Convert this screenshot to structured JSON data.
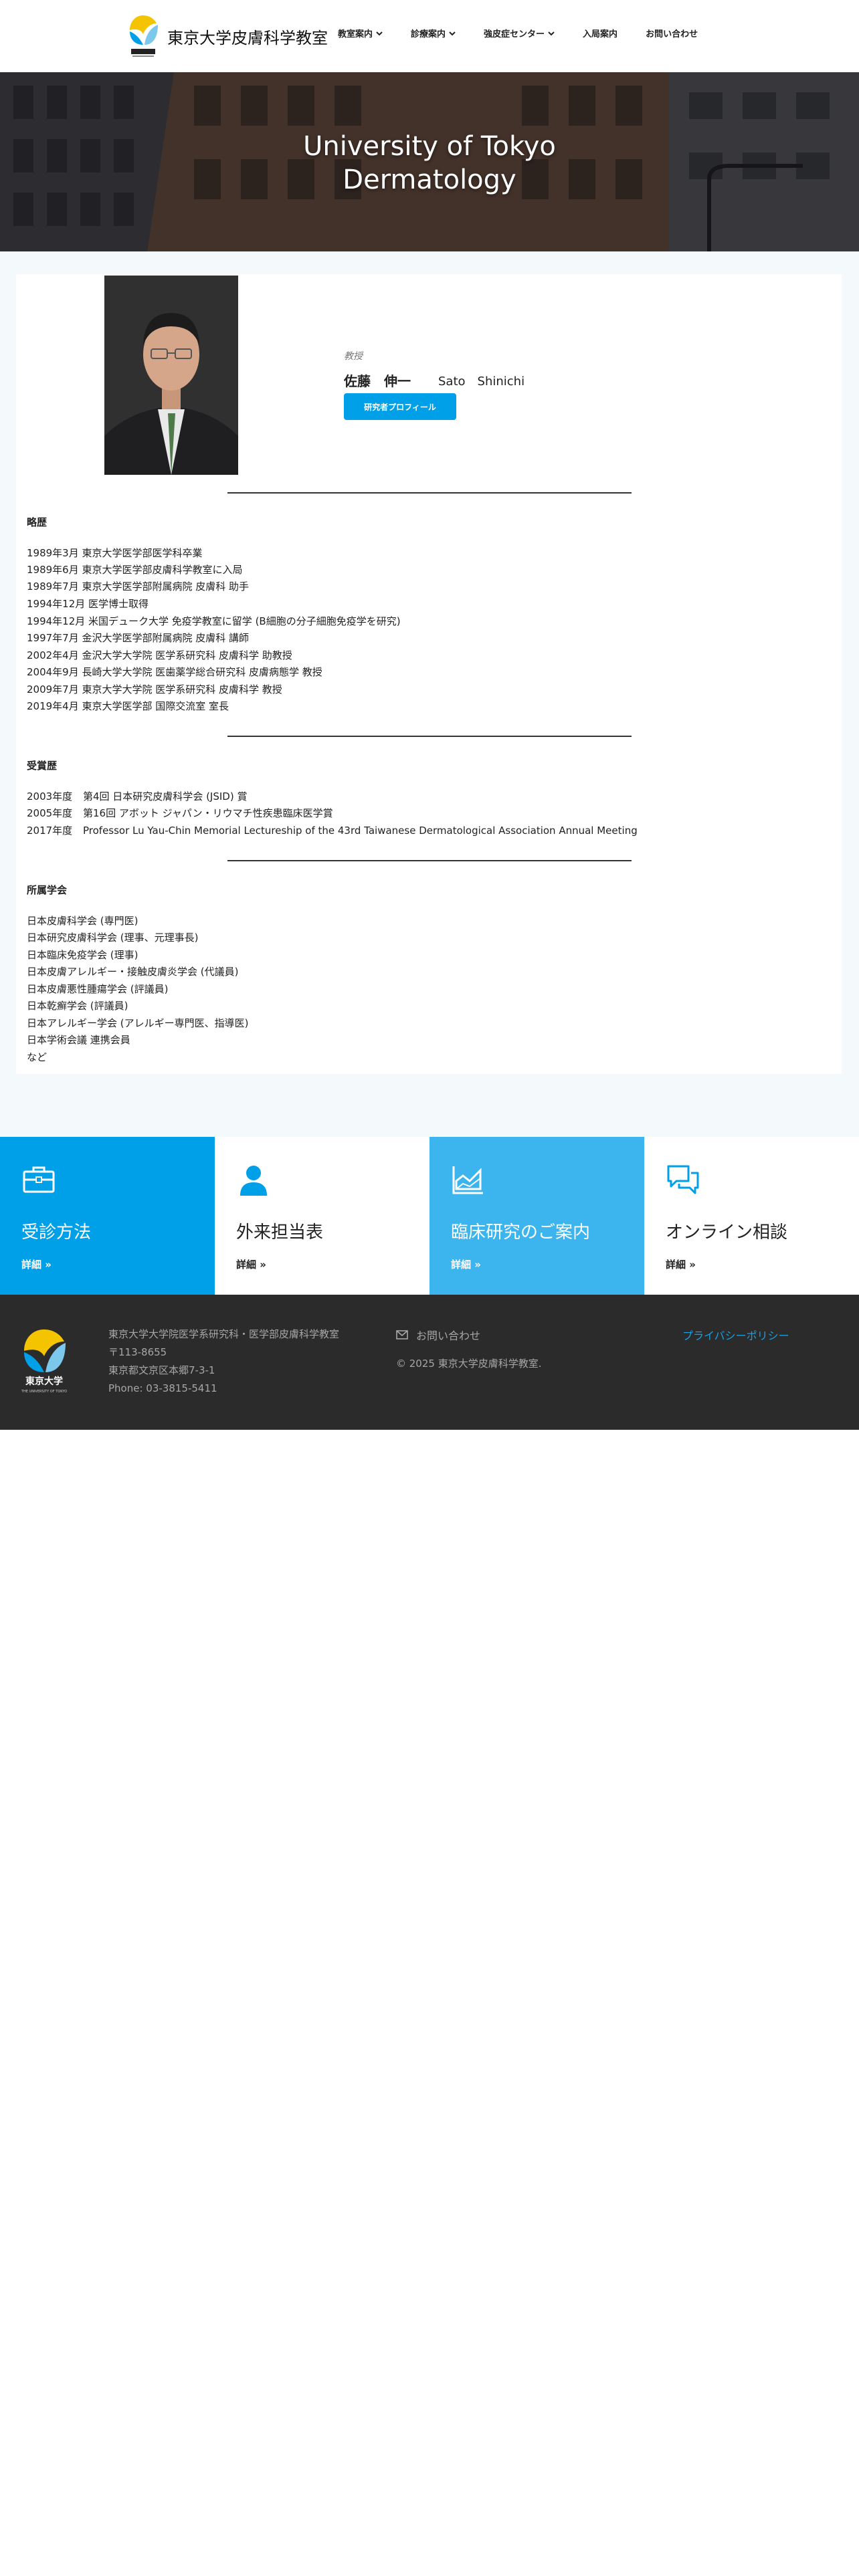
{
  "header": {
    "site_title": "東京大学皮膚科学教室",
    "logo_caption": "東京大学",
    "nav": [
      {
        "label": "教室案内",
        "dropdown": true
      },
      {
        "label": "診療案内",
        "dropdown": true
      },
      {
        "label": "強皮症センター",
        "dropdown": true
      },
      {
        "label": "入局案内",
        "dropdown": false
      },
      {
        "label": "お問い合わせ",
        "dropdown": false
      }
    ]
  },
  "hero": {
    "title_line1": "University of Tokyo",
    "title_line2": "Dermatology"
  },
  "profile": {
    "role": "教授",
    "name_ja": "佐藤　伸一",
    "name_en": "Sato　Shinichi",
    "button_label": "研究者プロフィール"
  },
  "history": {
    "heading": "略歴",
    "items": [
      "1989年3月  東京大学医学部医学科卒業",
      "1989年6月 東京大学医学部皮膚科学教室に入局",
      "1989年7月  東京大学医学部附属病院 皮膚科 助手",
      "1994年12月 医学博士取得",
      "1994年12月 米国デューク大学 免疫学教室に留学 (B細胞の分子細胞免疫学を研究)",
      "1997年7月  金沢大学医学部附属病院 皮膚科 講師",
      "2002年4月  金沢大学大学院 医学系研究科 皮膚科学 助教授",
      "2004年9月  長崎大学大学院 医歯薬学総合研究科 皮膚病態学 教授",
      "2009年7月  東京大学大学院 医学系研究科 皮膚科学 教授",
      "2019年4月 東京大学医学部 国際交流室 室長"
    ]
  },
  "awards": {
    "heading": "受賞歴",
    "items": [
      {
        "year": "2003年度",
        "text": "第4回 日本研究皮膚科学会 (JSID) 賞"
      },
      {
        "year": "2005年度",
        "text": "第16回 アボット ジャパン・リウマチ性疾患臨床医学賞"
      },
      {
        "year": "2017年度",
        "text": "Professor Lu Yau-Chin Memorial Lectureship of the 43rd Taiwanese Dermatological Association Annual Meeting"
      }
    ]
  },
  "societies": {
    "heading": "所属学会",
    "items": [
      "日本皮膚科学会 (専門医)",
      "日本研究皮膚科学会 (理事、元理事長)",
      "日本臨床免疫学会 (理事)",
      "日本皮膚アレルギー・接触皮膚炎学会 (代議員)",
      "日本皮膚悪性腫瘍学会 (評議員)",
      "日本乾癬学会 (評議員)",
      "日本アレルギー学会 (アレルギー専門医、指導医)",
      "日本学術会議 連携会員",
      "など"
    ]
  },
  "tiles": [
    {
      "title": "受診方法",
      "link": "詳細",
      "icon": "briefcase-icon",
      "style": "blue"
    },
    {
      "title": "外来担当表",
      "link": "詳細",
      "icon": "person-icon",
      "style": "white"
    },
    {
      "title": "臨床研究のご案内",
      "link": "詳細",
      "icon": "area-chart-icon",
      "style": "lblue"
    },
    {
      "title": "オンライン相談",
      "link": "詳細",
      "icon": "chat-bubbles-icon",
      "style": "white"
    }
  ],
  "footer": {
    "address_lines": [
      "東京大学大学院医学系研究科・医学部皮膚科学教室",
      "〒113-8655",
      "東京都文京区本郷7-3-1",
      "Phone: 03-3815-5411"
    ],
    "contact_label": "お問い合わせ",
    "copyright": "© 2025 東京大学皮膚科学教室.",
    "privacy_label": "プライバシーポリシー",
    "logo_caption": "東京大学",
    "logo_subcaption": "THE UNIVERSITY OF TOKYO"
  },
  "colors": {
    "accent": "#00a0e9",
    "accent_light": "#3cb4ee",
    "footer_bg": "#2b2b2b",
    "content_bg": "#f4fafc",
    "privacy_link": "#1a9fe0"
  }
}
